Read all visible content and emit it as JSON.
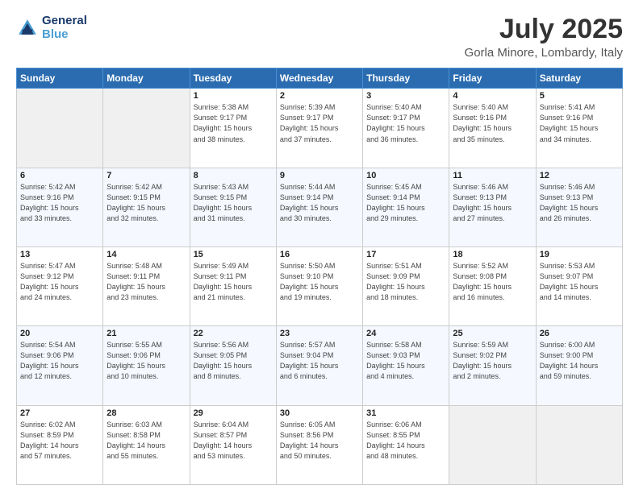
{
  "header": {
    "logo_line1": "General",
    "logo_line2": "Blue",
    "month": "July 2025",
    "location": "Gorla Minore, Lombardy, Italy"
  },
  "weekdays": [
    "Sunday",
    "Monday",
    "Tuesday",
    "Wednesday",
    "Thursday",
    "Friday",
    "Saturday"
  ],
  "weeks": [
    [
      {
        "day": "",
        "info": ""
      },
      {
        "day": "",
        "info": ""
      },
      {
        "day": "1",
        "info": "Sunrise: 5:38 AM\nSunset: 9:17 PM\nDaylight: 15 hours\nand 38 minutes."
      },
      {
        "day": "2",
        "info": "Sunrise: 5:39 AM\nSunset: 9:17 PM\nDaylight: 15 hours\nand 37 minutes."
      },
      {
        "day": "3",
        "info": "Sunrise: 5:40 AM\nSunset: 9:17 PM\nDaylight: 15 hours\nand 36 minutes."
      },
      {
        "day": "4",
        "info": "Sunrise: 5:40 AM\nSunset: 9:16 PM\nDaylight: 15 hours\nand 35 minutes."
      },
      {
        "day": "5",
        "info": "Sunrise: 5:41 AM\nSunset: 9:16 PM\nDaylight: 15 hours\nand 34 minutes."
      }
    ],
    [
      {
        "day": "6",
        "info": "Sunrise: 5:42 AM\nSunset: 9:16 PM\nDaylight: 15 hours\nand 33 minutes."
      },
      {
        "day": "7",
        "info": "Sunrise: 5:42 AM\nSunset: 9:15 PM\nDaylight: 15 hours\nand 32 minutes."
      },
      {
        "day": "8",
        "info": "Sunrise: 5:43 AM\nSunset: 9:15 PM\nDaylight: 15 hours\nand 31 minutes."
      },
      {
        "day": "9",
        "info": "Sunrise: 5:44 AM\nSunset: 9:14 PM\nDaylight: 15 hours\nand 30 minutes."
      },
      {
        "day": "10",
        "info": "Sunrise: 5:45 AM\nSunset: 9:14 PM\nDaylight: 15 hours\nand 29 minutes."
      },
      {
        "day": "11",
        "info": "Sunrise: 5:46 AM\nSunset: 9:13 PM\nDaylight: 15 hours\nand 27 minutes."
      },
      {
        "day": "12",
        "info": "Sunrise: 5:46 AM\nSunset: 9:13 PM\nDaylight: 15 hours\nand 26 minutes."
      }
    ],
    [
      {
        "day": "13",
        "info": "Sunrise: 5:47 AM\nSunset: 9:12 PM\nDaylight: 15 hours\nand 24 minutes."
      },
      {
        "day": "14",
        "info": "Sunrise: 5:48 AM\nSunset: 9:11 PM\nDaylight: 15 hours\nand 23 minutes."
      },
      {
        "day": "15",
        "info": "Sunrise: 5:49 AM\nSunset: 9:11 PM\nDaylight: 15 hours\nand 21 minutes."
      },
      {
        "day": "16",
        "info": "Sunrise: 5:50 AM\nSunset: 9:10 PM\nDaylight: 15 hours\nand 19 minutes."
      },
      {
        "day": "17",
        "info": "Sunrise: 5:51 AM\nSunset: 9:09 PM\nDaylight: 15 hours\nand 18 minutes."
      },
      {
        "day": "18",
        "info": "Sunrise: 5:52 AM\nSunset: 9:08 PM\nDaylight: 15 hours\nand 16 minutes."
      },
      {
        "day": "19",
        "info": "Sunrise: 5:53 AM\nSunset: 9:07 PM\nDaylight: 15 hours\nand 14 minutes."
      }
    ],
    [
      {
        "day": "20",
        "info": "Sunrise: 5:54 AM\nSunset: 9:06 PM\nDaylight: 15 hours\nand 12 minutes."
      },
      {
        "day": "21",
        "info": "Sunrise: 5:55 AM\nSunset: 9:06 PM\nDaylight: 15 hours\nand 10 minutes."
      },
      {
        "day": "22",
        "info": "Sunrise: 5:56 AM\nSunset: 9:05 PM\nDaylight: 15 hours\nand 8 minutes."
      },
      {
        "day": "23",
        "info": "Sunrise: 5:57 AM\nSunset: 9:04 PM\nDaylight: 15 hours\nand 6 minutes."
      },
      {
        "day": "24",
        "info": "Sunrise: 5:58 AM\nSunset: 9:03 PM\nDaylight: 15 hours\nand 4 minutes."
      },
      {
        "day": "25",
        "info": "Sunrise: 5:59 AM\nSunset: 9:02 PM\nDaylight: 15 hours\nand 2 minutes."
      },
      {
        "day": "26",
        "info": "Sunrise: 6:00 AM\nSunset: 9:00 PM\nDaylight: 14 hours\nand 59 minutes."
      }
    ],
    [
      {
        "day": "27",
        "info": "Sunrise: 6:02 AM\nSunset: 8:59 PM\nDaylight: 14 hours\nand 57 minutes."
      },
      {
        "day": "28",
        "info": "Sunrise: 6:03 AM\nSunset: 8:58 PM\nDaylight: 14 hours\nand 55 minutes."
      },
      {
        "day": "29",
        "info": "Sunrise: 6:04 AM\nSunset: 8:57 PM\nDaylight: 14 hours\nand 53 minutes."
      },
      {
        "day": "30",
        "info": "Sunrise: 6:05 AM\nSunset: 8:56 PM\nDaylight: 14 hours\nand 50 minutes."
      },
      {
        "day": "31",
        "info": "Sunrise: 6:06 AM\nSunset: 8:55 PM\nDaylight: 14 hours\nand 48 minutes."
      },
      {
        "day": "",
        "info": ""
      },
      {
        "day": "",
        "info": ""
      }
    ]
  ]
}
